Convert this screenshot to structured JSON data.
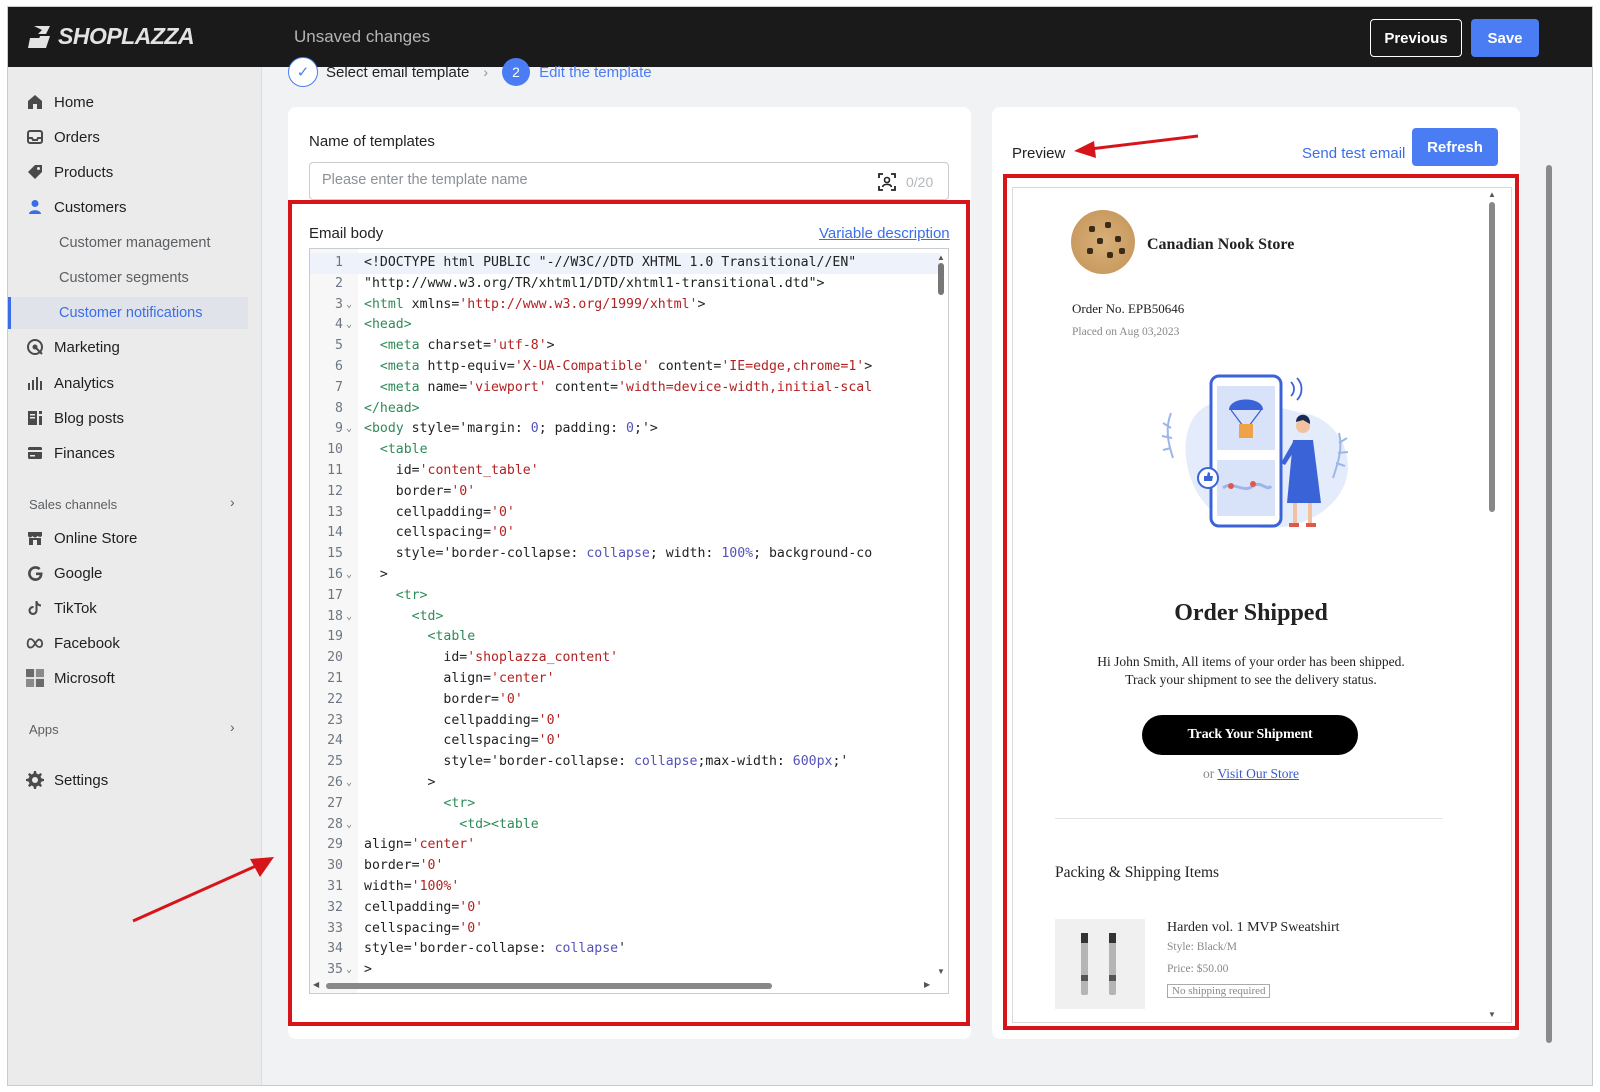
{
  "topbar": {
    "logo": "SHOPLAZZA",
    "status": "Unsaved changes",
    "previous_label": "Previous",
    "save_label": "Save"
  },
  "sidebar": {
    "items": [
      {
        "label": "Home",
        "icon": "home-icon"
      },
      {
        "label": "Orders",
        "icon": "inbox-icon"
      },
      {
        "label": "Products",
        "icon": "tag-icon"
      },
      {
        "label": "Customers",
        "icon": "person-icon"
      }
    ],
    "customer_sub": [
      {
        "label": "Customer management"
      },
      {
        "label": "Customer segments"
      },
      {
        "label": "Customer notifications"
      }
    ],
    "items2": [
      {
        "label": "Marketing",
        "icon": "marketing-icon"
      },
      {
        "label": "Analytics",
        "icon": "bar-chart-icon"
      },
      {
        "label": "Blog posts",
        "icon": "blog-icon"
      },
      {
        "label": "Finances",
        "icon": "finance-icon"
      }
    ],
    "sales_channels_heading": "Sales channels",
    "channels": [
      {
        "label": "Online Store",
        "icon": "store-icon"
      },
      {
        "label": "Google",
        "icon": "google-icon"
      },
      {
        "label": "TikTok",
        "icon": "tiktok-icon"
      },
      {
        "label": "Facebook",
        "icon": "meta-icon"
      },
      {
        "label": "Microsoft",
        "icon": "microsoft-icon"
      }
    ],
    "apps_heading": "Apps",
    "settings_label": "Settings"
  },
  "steps": {
    "step1": "Select email template",
    "step2_number": "2",
    "step2": "Edit the template"
  },
  "template_form": {
    "name_label": "Name of templates",
    "name_placeholder": "Please enter the template name",
    "name_counter": "0/20",
    "body_label": "Email body",
    "variable_link": "Variable description"
  },
  "code_lines": [
    [
      [
        "d",
        "<!DOCTYPE html PUBLIC \"-//W3C//DTD XHTML 1.0 Transitional//EN\""
      ]
    ],
    [
      [
        "d",
        "\"http://www.w3.org/TR/xhtml1/DTD/xhtml1-transitional.dtd\">"
      ]
    ],
    [
      [
        "t",
        "<html"
      ],
      [
        "d",
        " xmlns="
      ],
      [
        "s",
        "'http://www.w3.org/1999/xhtml'"
      ],
      [
        "d",
        ">"
      ]
    ],
    [
      [
        "t",
        "<head>"
      ]
    ],
    [
      [
        "d",
        "  "
      ],
      [
        "t",
        "<meta"
      ],
      [
        "d",
        " charset="
      ],
      [
        "s",
        "'utf-8'"
      ],
      [
        "d",
        ">"
      ]
    ],
    [
      [
        "d",
        "  "
      ],
      [
        "t",
        "<meta"
      ],
      [
        "d",
        " http-equiv="
      ],
      [
        "s",
        "'X-UA-Compatible'"
      ],
      [
        "d",
        " content="
      ],
      [
        "s",
        "'IE=edge,chrome=1'"
      ],
      [
        "d",
        ">"
      ]
    ],
    [
      [
        "d",
        "  "
      ],
      [
        "t",
        "<meta"
      ],
      [
        "d",
        " name="
      ],
      [
        "s",
        "'viewport'"
      ],
      [
        "d",
        " content="
      ],
      [
        "s",
        "'width=device-width,initial-scal"
      ]
    ],
    [
      [
        "t",
        "</head>"
      ]
    ],
    [
      [
        "t",
        "<body"
      ],
      [
        "d",
        " style='margin: "
      ],
      [
        "k",
        "0"
      ],
      [
        "d",
        "; padding: "
      ],
      [
        "k",
        "0"
      ],
      [
        "d",
        ";'>"
      ]
    ],
    [
      [
        "d",
        "  "
      ],
      [
        "t",
        "<table"
      ]
    ],
    [
      [
        "d",
        "    id="
      ],
      [
        "s",
        "'content_table'"
      ]
    ],
    [
      [
        "d",
        "    border="
      ],
      [
        "s",
        "'0'"
      ]
    ],
    [
      [
        "d",
        "    cellpadding="
      ],
      [
        "s",
        "'0'"
      ]
    ],
    [
      [
        "d",
        "    cellspacing="
      ],
      [
        "s",
        "'0'"
      ]
    ],
    [
      [
        "d",
        "    style='border-collapse: "
      ],
      [
        "k",
        "collapse"
      ],
      [
        "d",
        "; width: "
      ],
      [
        "k",
        "100%"
      ],
      [
        "d",
        "; background-co"
      ]
    ],
    [
      [
        "d",
        "  >"
      ]
    ],
    [
      [
        "d",
        "    "
      ],
      [
        "t",
        "<tr>"
      ]
    ],
    [
      [
        "d",
        "      "
      ],
      [
        "t",
        "<td>"
      ]
    ],
    [
      [
        "d",
        "        "
      ],
      [
        "t",
        "<table"
      ]
    ],
    [
      [
        "d",
        "          id="
      ],
      [
        "s",
        "'shoplazza_content'"
      ]
    ],
    [
      [
        "d",
        "          align="
      ],
      [
        "s",
        "'center'"
      ]
    ],
    [
      [
        "d",
        "          border="
      ],
      [
        "s",
        "'0'"
      ]
    ],
    [
      [
        "d",
        "          cellpadding="
      ],
      [
        "s",
        "'0'"
      ]
    ],
    [
      [
        "d",
        "          cellspacing="
      ],
      [
        "s",
        "'0'"
      ]
    ],
    [
      [
        "d",
        "          style='border-collapse: "
      ],
      [
        "k",
        "collapse"
      ],
      [
        "d",
        ";max-width: "
      ],
      [
        "k",
        "600px"
      ],
      [
        "d",
        ";'"
      ]
    ],
    [
      [
        "d",
        "        >"
      ]
    ],
    [
      [
        "d",
        "          "
      ],
      [
        "t",
        "<tr>"
      ]
    ],
    [
      [
        "d",
        "            "
      ],
      [
        "t",
        "<td><table"
      ]
    ],
    [
      [
        "d",
        "align="
      ],
      [
        "s",
        "'center'"
      ]
    ],
    [
      [
        "d",
        "border="
      ],
      [
        "s",
        "'0'"
      ]
    ],
    [
      [
        "d",
        "width="
      ],
      [
        "s",
        "'100%'"
      ]
    ],
    [
      [
        "d",
        "cellpadding="
      ],
      [
        "s",
        "'0'"
      ]
    ],
    [
      [
        "d",
        "cellspacing="
      ],
      [
        "s",
        "'0'"
      ]
    ],
    [
      [
        "d",
        "style='border-collapse: "
      ],
      [
        "k",
        "collapse"
      ],
      [
        "d",
        "'"
      ]
    ],
    [
      [
        "d",
        ">"
      ]
    ]
  ],
  "fold_lines": [
    3,
    4,
    9,
    16,
    18,
    26,
    28,
    35
  ],
  "preview": {
    "title": "Preview",
    "send_test_label": "Send test email",
    "refresh_label": "Refresh",
    "store_name": "Canadian Nook Store",
    "order_no": "Order No. EPB50646",
    "placed_on": "Placed on Aug 03,2023",
    "heading": "Order Shipped",
    "message_line1": "Hi John Smith, All items of your order has been shipped.",
    "message_line2": "Track your shipment to see the delivery status.",
    "track_button": "Track Your Shipment",
    "or_text": "or",
    "visit_store_link": "Visit Our Store",
    "packing_heading": "Packing & Shipping Items",
    "product": {
      "name": "Harden vol. 1 MVP Sweatshirt",
      "style": "Style: Black/M",
      "price": "Price: $50.00",
      "badge": "No shipping required"
    }
  },
  "colors": {
    "accent": "#4a7cf3",
    "annotation_red": "#d8141b",
    "topbar": "#1a1a1a"
  }
}
